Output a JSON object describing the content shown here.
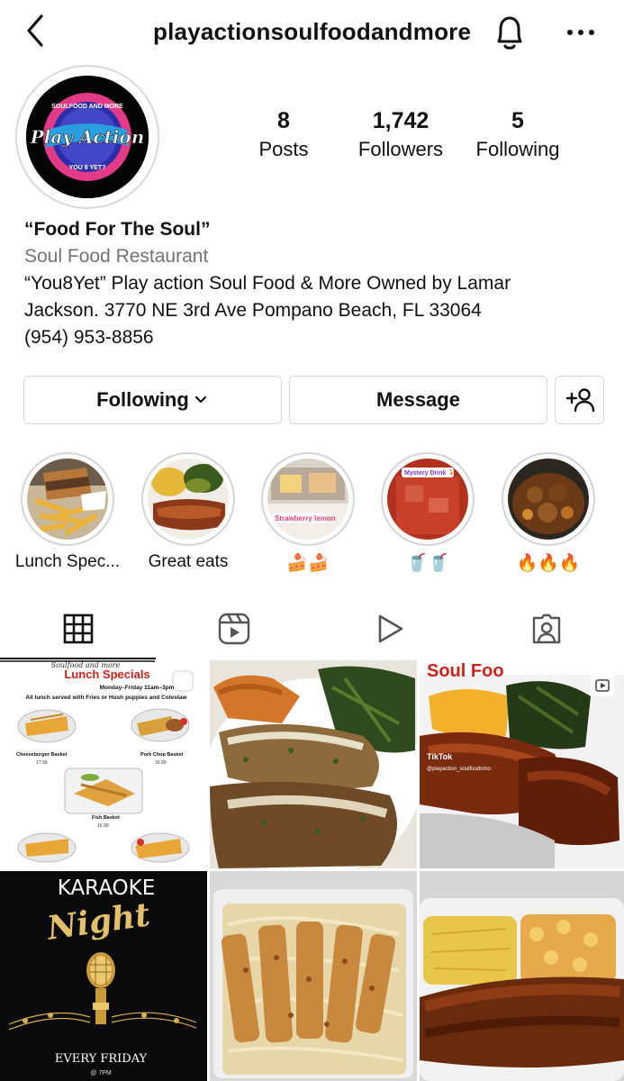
{
  "header": {
    "username": "playactionsoulfoodandmore",
    "back_icon": "chevron-left-icon",
    "bell_icon": "bell-icon",
    "more_icon": "more-horizontal-icon"
  },
  "profile": {
    "avatar": {
      "logo_top": "SOULFOOD AND MORE",
      "logo_main": "Play Action",
      "logo_bottom": "YOU 8 YET?"
    },
    "stats": [
      {
        "value": "8",
        "label": "Posts"
      },
      {
        "value": "1,742",
        "label": "Followers"
      },
      {
        "value": "5",
        "label": "Following"
      }
    ],
    "bio": {
      "name": "“Food For The Soul”",
      "category": "Soul Food Restaurant",
      "line1": "“You8Yet” Play action Soul Food & More Owned by Lamar",
      "line2": "Jackson. 3770 NE 3rd Ave Pompano Beach, FL 33064",
      "line3": "(954) 953-8856"
    }
  },
  "actions": {
    "following_label": "Following",
    "message_label": "Message",
    "add_user_icon": "add-user-icon"
  },
  "highlights": [
    {
      "label": "Lunch Spec...",
      "image": "sandwich and fries"
    },
    {
      "label": "Great eats",
      "image": "plated soul food"
    },
    {
      "label": "🍰🍰",
      "image": "strawberry lemon cake",
      "overlay": "Strawberry lemon"
    },
    {
      "label": "🥤🥤",
      "image": "red mystery drink",
      "overlay": "Mystery Drink 🍹"
    },
    {
      "label": "🔥🔥🔥",
      "image": "oxtail stew"
    }
  ],
  "tabs": [
    {
      "name": "grid",
      "icon": "grid-icon",
      "active": true
    },
    {
      "name": "reels",
      "icon": "reels-icon",
      "active": false
    },
    {
      "name": "videos",
      "icon": "play-icon",
      "active": false
    },
    {
      "name": "tagged",
      "icon": "tagged-user-icon",
      "active": false
    }
  ],
  "posts": {
    "lunch_menu": {
      "brand": "Soulfood and more",
      "title": "Lunch Specials",
      "hours": "Monday–Friday 11am–3pm",
      "subtitle": "All lunch served with Fries or Hush puppies and Colestaw",
      "item1_name": "Cheeseburger Basket",
      "item1_price": "17.99",
      "item2_name": "Pork Chop Basket",
      "item2_price": "16.99",
      "item3_name": "Fish Basket",
      "item3_price": "16.99"
    },
    "soul_food_post": {
      "sign_text": "Soul Foo",
      "watermark": "TikTok",
      "handle": "@playaction_soulfoodnmo"
    },
    "karaoke": {
      "title": "KARAOKE",
      "script": "Night",
      "day": "EVERY FRIDAY",
      "time": "@ 7PM"
    }
  },
  "colors": {
    "menu_red": "#d0201a",
    "karaoke_gold": "#d6b04a",
    "divider": "#dbdbdb",
    "secondary_text": "#737373"
  }
}
